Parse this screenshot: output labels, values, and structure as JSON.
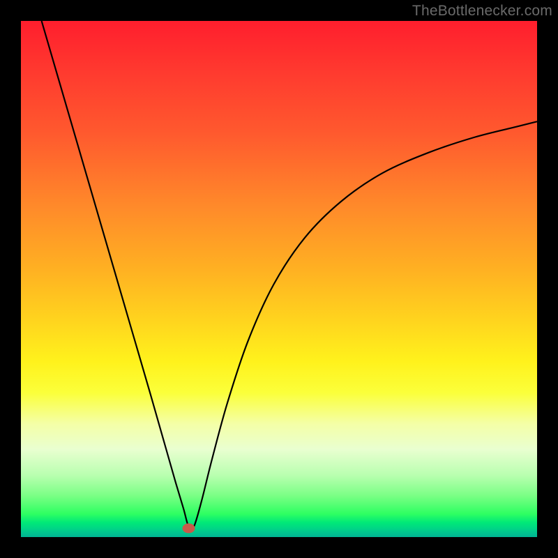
{
  "watermark": "TheBottlenecker.com",
  "marker": {
    "x_frac": 0.325,
    "y_frac": 0.983,
    "fill": "#c85a4a",
    "rx": 9,
    "ry": 7
  },
  "chart_data": {
    "type": "line",
    "title": "",
    "xlabel": "",
    "ylabel": "",
    "xlim": [
      0,
      1
    ],
    "ylim": [
      0,
      1
    ],
    "grid": false,
    "legend": false,
    "series": [
      {
        "name": "bottleneck-curve",
        "stroke": "#000000",
        "stroke_width": 2.2,
        "x": [
          0.04,
          0.075,
          0.11,
          0.145,
          0.18,
          0.215,
          0.25,
          0.28,
          0.3,
          0.315,
          0.325,
          0.335,
          0.35,
          0.37,
          0.4,
          0.44,
          0.49,
          0.55,
          0.62,
          0.7,
          0.79,
          0.88,
          0.96,
          1.0
        ],
        "y": [
          1.0,
          0.88,
          0.76,
          0.64,
          0.52,
          0.4,
          0.28,
          0.175,
          0.105,
          0.055,
          0.02,
          0.02,
          0.07,
          0.15,
          0.26,
          0.38,
          0.49,
          0.58,
          0.65,
          0.705,
          0.745,
          0.775,
          0.795,
          0.805
        ]
      }
    ],
    "annotations": [
      {
        "type": "marker",
        "shape": "ellipse",
        "x": 0.325,
        "y": 0.017,
        "note": "minimum-point"
      }
    ]
  }
}
